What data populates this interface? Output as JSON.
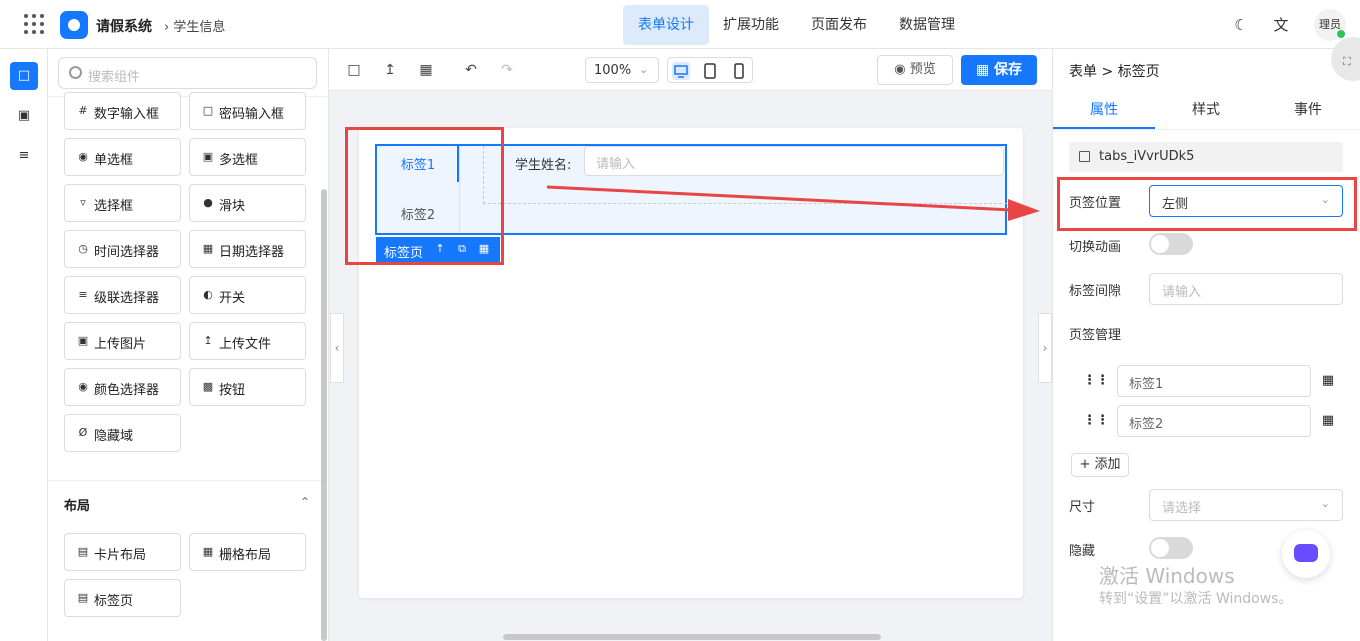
{
  "header": {
    "app_name": "请假系统",
    "breadcrumb": "学生信息",
    "nav_tabs": [
      "表单设计",
      "扩展功能",
      "页面发布",
      "数据管理"
    ],
    "active_tab": "表单设计",
    "avatar_text": "理员"
  },
  "panel": {
    "search_placeholder": "搜索组件",
    "components": [
      {
        "label": "数字输入框",
        "icon": "number-icon"
      },
      {
        "label": "密码输入框",
        "icon": "lock-icon"
      },
      {
        "label": "单选框",
        "icon": "radio-icon"
      },
      {
        "label": "多选框",
        "icon": "checkbox-icon"
      },
      {
        "label": "选择框",
        "icon": "select-icon"
      },
      {
        "label": "滑块",
        "icon": "slider-icon"
      },
      {
        "label": "时间选择器",
        "icon": "clock-icon"
      },
      {
        "label": "日期选择器",
        "icon": "calendar-icon"
      },
      {
        "label": "级联选择器",
        "icon": "cascader-icon"
      },
      {
        "label": "开关",
        "icon": "switch-icon"
      },
      {
        "label": "上传图片",
        "icon": "image-icon"
      },
      {
        "label": "上传文件",
        "icon": "upload-icon"
      },
      {
        "label": "颜色选择器",
        "icon": "palette-icon"
      },
      {
        "label": "按钮",
        "icon": "button-icon"
      },
      {
        "label": "隐藏域",
        "icon": "eye-off-icon"
      }
    ],
    "layout_section": "布局",
    "layout_components": [
      {
        "label": "卡片布局",
        "icon": "card-icon"
      },
      {
        "label": "栅格布局",
        "icon": "grid-icon"
      },
      {
        "label": "标签页",
        "icon": "tabs-icon"
      }
    ]
  },
  "toolbar": {
    "zoom": "100%",
    "preview_label": "预览",
    "save_label": "保存"
  },
  "canvas": {
    "tabs": [
      "标签1",
      "标签2"
    ],
    "active_tab": "标签1",
    "field_label": "学生姓名:",
    "field_placeholder": "请输入",
    "selected_tag": "标签页"
  },
  "props": {
    "breadcrumb": "表单 > 标签页",
    "tabs": [
      "属性",
      "样式",
      "事件"
    ],
    "active_tab": "属性",
    "component_id": "tabs_iVvrUDk5",
    "tab_position_label": "页签位置",
    "tab_position_value": "左侧",
    "animation_label": "切换动画",
    "animation_on": false,
    "gap_label": "标签间隙",
    "gap_placeholder": "请输入",
    "manage_label": "页签管理",
    "tab_items": [
      "标签1",
      "标签2"
    ],
    "add_label": "+ 添加",
    "size_label": "尺寸",
    "size_placeholder": "请选择",
    "hidden_label": "隐藏",
    "hidden_on": false
  },
  "watermark": {
    "line1": "激活 Windows",
    "line2": "转到“设置”以激活 Windows。"
  },
  "colors": {
    "accent": "#1677ff",
    "annotation": "#e84545"
  }
}
